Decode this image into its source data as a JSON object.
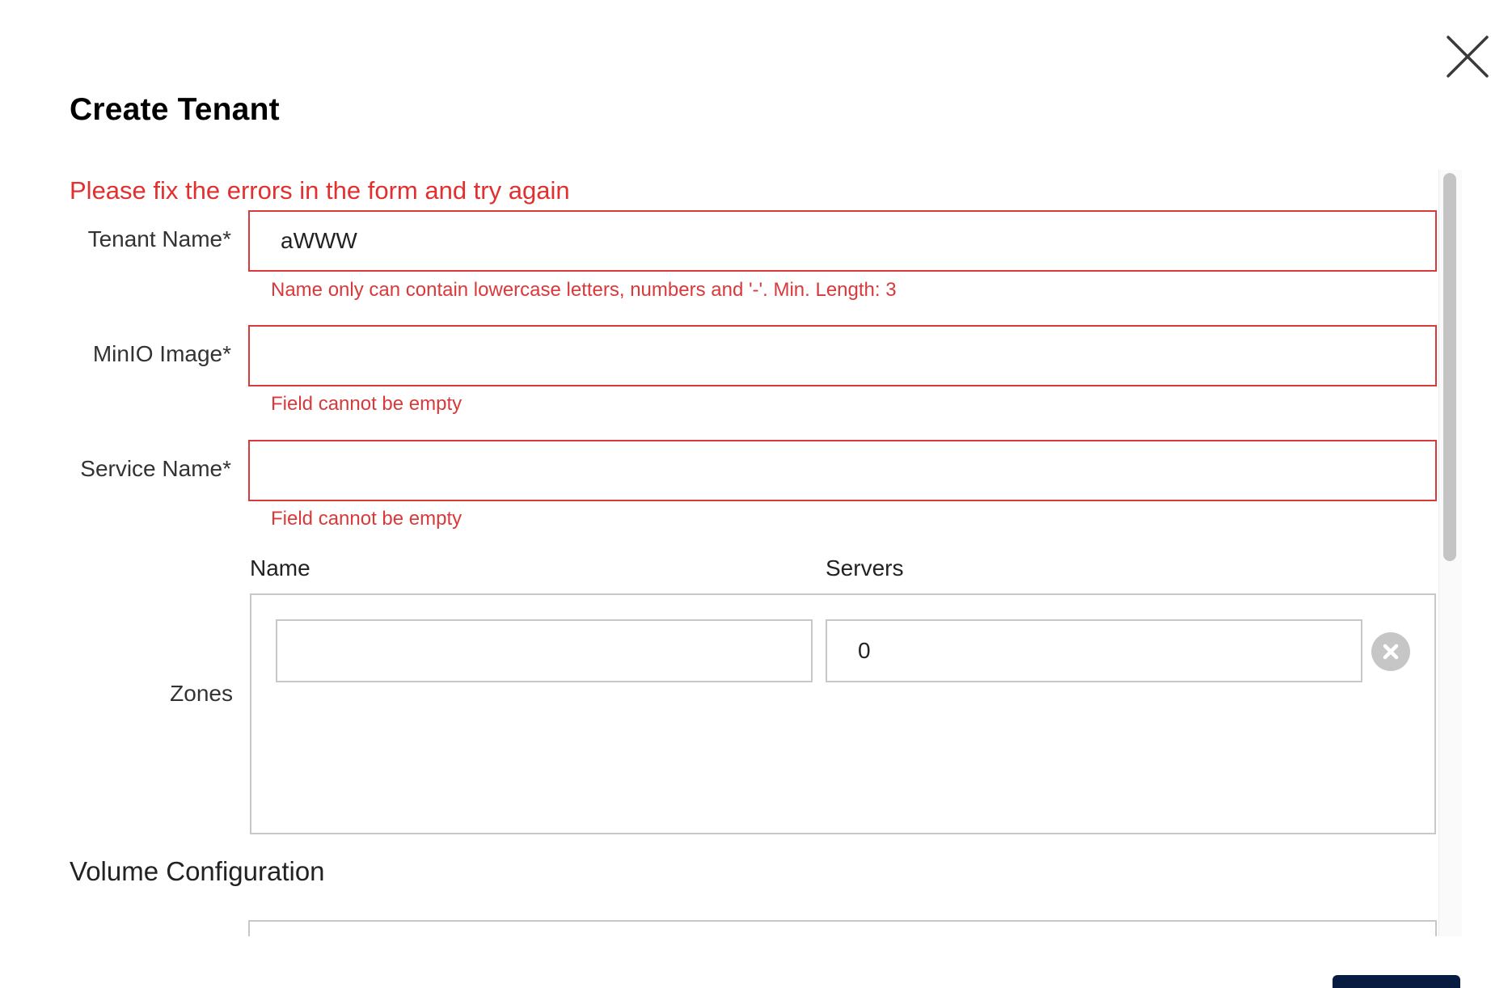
{
  "dialog": {
    "title": "Create Tenant",
    "form_error": "Please fix the errors in the form and try again"
  },
  "fields": {
    "tenant_name": {
      "label": "Tenant Name*",
      "value": "aWWW",
      "error": "Name only can contain lowercase letters, numbers and '-'. Min. Length: 3"
    },
    "minio_image": {
      "label": "MinIO Image*",
      "value": "",
      "error": "Field cannot be empty"
    },
    "service_name": {
      "label": "Service Name*",
      "value": "",
      "error": "Field cannot be empty"
    }
  },
  "zones": {
    "label": "Zones",
    "columns": [
      "Name",
      "Servers"
    ],
    "rows": [
      {
        "name": "",
        "servers": "0"
      }
    ]
  },
  "volume_configuration": {
    "title": "Volume Configuration"
  },
  "colors": {
    "error": "#d9393a",
    "primary": "#081c42"
  }
}
